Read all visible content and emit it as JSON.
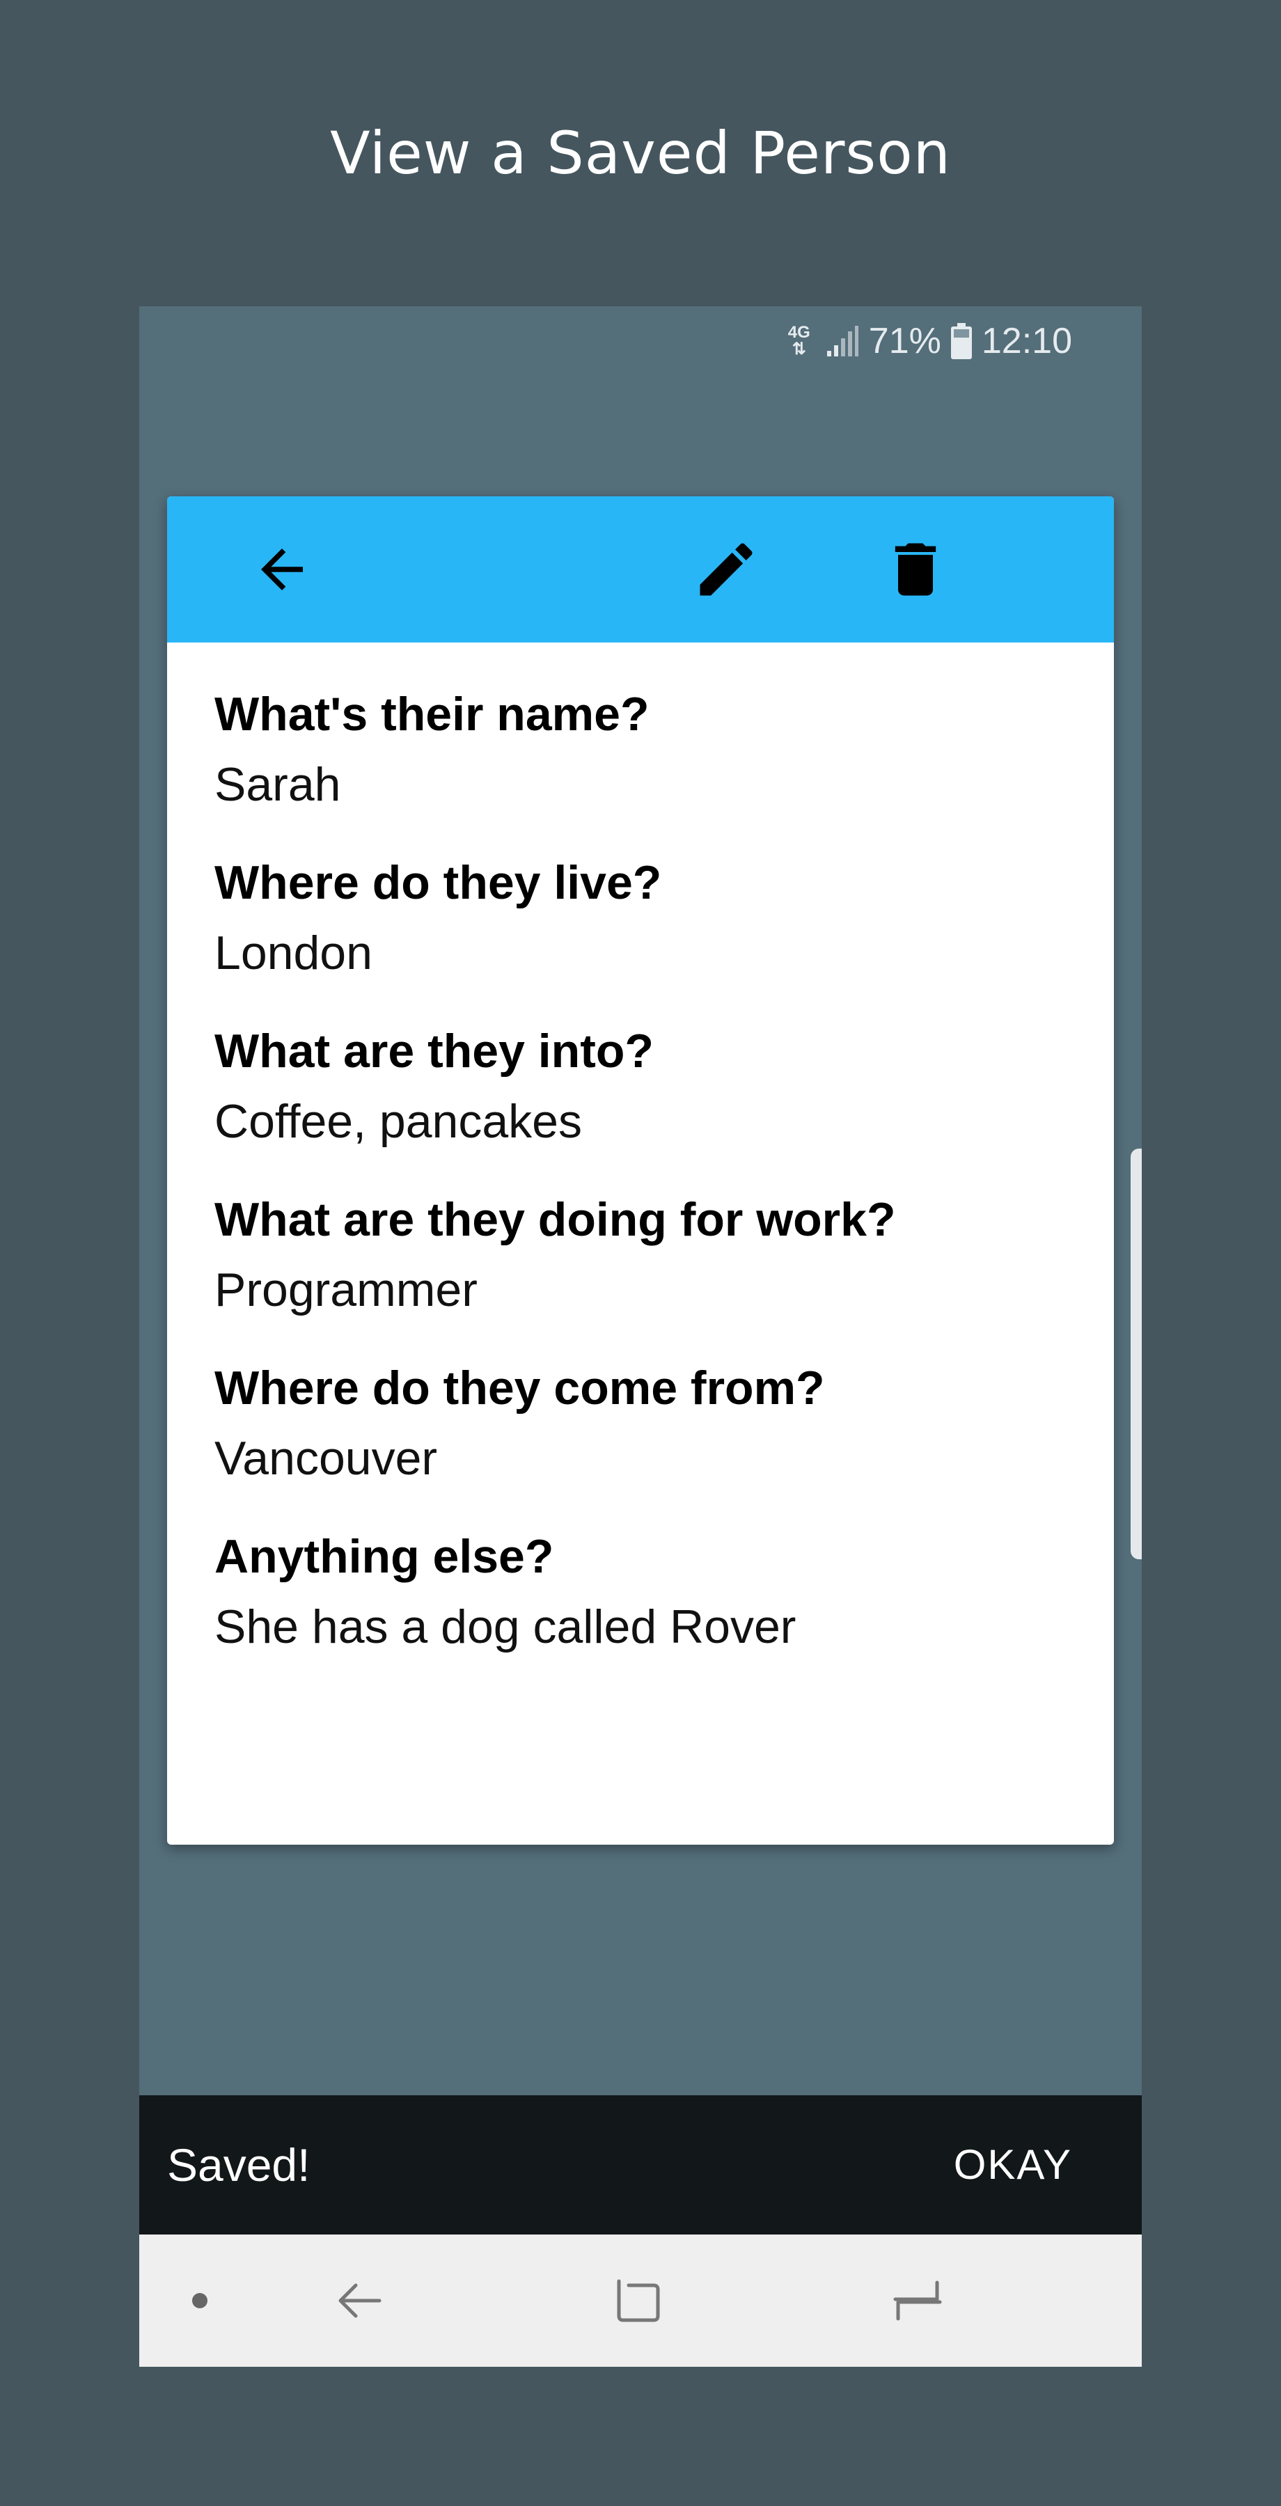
{
  "page_title": "View a Saved Person",
  "status_bar": {
    "network": "4G",
    "battery": "71%",
    "time": "12:10"
  },
  "toolbar": {
    "icons": [
      "back-arrow-icon",
      "edit-pencil-icon",
      "delete-trash-icon"
    ]
  },
  "fields": [
    {
      "question": "What's their name?",
      "answer": "Sarah"
    },
    {
      "question": "Where do they live?",
      "answer": "London"
    },
    {
      "question": "What are they into?",
      "answer": "Coffee, pancakes"
    },
    {
      "question": "What are they doing for work?",
      "answer": "Programmer"
    },
    {
      "question": "Where do they come from?",
      "answer": "Vancouver"
    },
    {
      "question": "Anything else?",
      "answer": "She has a dog called Rover"
    }
  ],
  "snackbar": {
    "message": "Saved!",
    "action": "OKAY"
  },
  "colors": {
    "background": "#45565e",
    "screen": "#546e7a",
    "toolbar": "#29b6f6",
    "snackbar": "#121719",
    "navbar": "#efefef"
  }
}
